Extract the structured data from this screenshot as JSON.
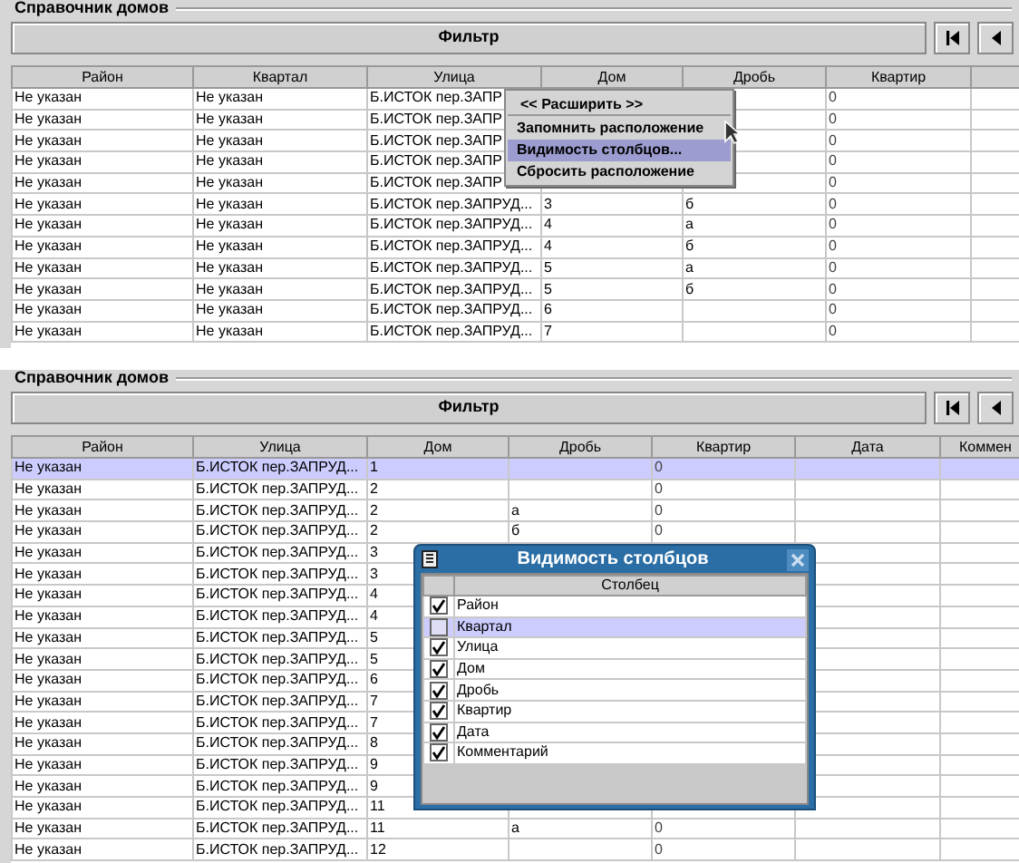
{
  "panels": [
    {
      "title": "Справочник домов",
      "filter_button": "Фильтр",
      "columns": [
        "Район",
        "Квартал",
        "Улица",
        "Дом",
        "Дробь",
        "Квартир"
      ],
      "rows": [
        {
          "selected": false,
          "cells": [
            "Не указан",
            "Не указан",
            "Б.ИСТОК пер.ЗАПР",
            null,
            null,
            "0"
          ]
        },
        {
          "selected": false,
          "cells": [
            "Не указан",
            "Не указан",
            "Б.ИСТОК пер.ЗАПР",
            null,
            null,
            "0"
          ]
        },
        {
          "selected": false,
          "cells": [
            "Не указан",
            "Не указан",
            "Б.ИСТОК пер.ЗАПР",
            null,
            null,
            "0"
          ]
        },
        {
          "selected": false,
          "cells": [
            "Не указан",
            "Не указан",
            "Б.ИСТОК пер.ЗАПР",
            null,
            null,
            "0"
          ]
        },
        {
          "selected": false,
          "cells": [
            "Не указан",
            "Не указан",
            "Б.ИСТОК пер.ЗАПР",
            null,
            null,
            "0"
          ]
        },
        {
          "selected": false,
          "cells": [
            "Не указан",
            "Не указан",
            "Б.ИСТОК пер.ЗАПРУД...",
            "3",
            "б",
            "0"
          ]
        },
        {
          "selected": false,
          "cells": [
            "Не указан",
            "Не указан",
            "Б.ИСТОК пер.ЗАПРУД...",
            "4",
            "а",
            "0"
          ]
        },
        {
          "selected": false,
          "cells": [
            "Не указан",
            "Не указан",
            "Б.ИСТОК пер.ЗАПРУД...",
            "4",
            "б",
            "0"
          ]
        },
        {
          "selected": false,
          "cells": [
            "Не указан",
            "Не указан",
            "Б.ИСТОК пер.ЗАПРУД...",
            "5",
            "а",
            "0"
          ]
        },
        {
          "selected": false,
          "cells": [
            "Не указан",
            "Не указан",
            "Б.ИСТОК пер.ЗАПРУД...",
            "5",
            "б",
            "0"
          ]
        },
        {
          "selected": false,
          "cells": [
            "Не указан",
            "Не указан",
            "Б.ИСТОК пер.ЗАПРУД...",
            "6",
            null,
            "0"
          ]
        },
        {
          "selected": false,
          "cells": [
            "Не указан",
            "Не указан",
            "Б.ИСТОК пер.ЗАПРУД...",
            "7",
            null,
            "0"
          ]
        }
      ],
      "context_menu": [
        {
          "label": "<< Расширить >>",
          "kind": "header",
          "selected": false
        },
        {
          "label": "Запомнить расположение",
          "kind": "item",
          "selected": false
        },
        {
          "label": "Видимость столбцов...",
          "kind": "item",
          "selected": true
        },
        {
          "label": "Сбросить расположение",
          "kind": "item",
          "selected": false
        }
      ]
    },
    {
      "title": "Справочник домов",
      "filter_button": "Фильтр",
      "columns": [
        "Район",
        "Улица",
        "Дом",
        "Дробь",
        "Квартир",
        "Дата",
        "Коммен"
      ],
      "rows": [
        {
          "selected": true,
          "cells": [
            "Не указан",
            "Б.ИСТОК пер.ЗАПРУД...",
            "1",
            null,
            "0",
            null,
            null
          ]
        },
        {
          "selected": false,
          "cells": [
            "Не указан",
            "Б.ИСТОК пер.ЗАПРУД...",
            "2",
            null,
            "0",
            null,
            null
          ]
        },
        {
          "selected": false,
          "cells": [
            "Не указан",
            "Б.ИСТОК пер.ЗАПРУД...",
            "2",
            "а",
            "0",
            null,
            null
          ]
        },
        {
          "selected": false,
          "cells": [
            "Не указан",
            "Б.ИСТОК пер.ЗАПРУД...",
            "2",
            "б",
            "0",
            null,
            null
          ]
        },
        {
          "selected": false,
          "cells": [
            "Не указан",
            "Б.ИСТОК пер.ЗАПРУД...",
            "3",
            null,
            null,
            null,
            null
          ]
        },
        {
          "selected": false,
          "cells": [
            "Не указан",
            "Б.ИСТОК пер.ЗАПРУД...",
            "3",
            null,
            null,
            null,
            null
          ]
        },
        {
          "selected": false,
          "cells": [
            "Не указан",
            "Б.ИСТОК пер.ЗАПРУД...",
            "4",
            null,
            null,
            null,
            null
          ]
        },
        {
          "selected": false,
          "cells": [
            "Не указан",
            "Б.ИСТОК пер.ЗАПРУД...",
            "4",
            null,
            null,
            null,
            null
          ]
        },
        {
          "selected": false,
          "cells": [
            "Не указан",
            "Б.ИСТОК пер.ЗАПРУД...",
            "5",
            null,
            null,
            null,
            null
          ]
        },
        {
          "selected": false,
          "cells": [
            "Не указан",
            "Б.ИСТОК пер.ЗАПРУД...",
            "5",
            null,
            null,
            null,
            null
          ]
        },
        {
          "selected": false,
          "cells": [
            "Не указан",
            "Б.ИСТОК пер.ЗАПРУД...",
            "6",
            null,
            null,
            null,
            null
          ]
        },
        {
          "selected": false,
          "cells": [
            "Не указан",
            "Б.ИСТОК пер.ЗАПРУД...",
            "7",
            null,
            null,
            null,
            null
          ]
        },
        {
          "selected": false,
          "cells": [
            "Не указан",
            "Б.ИСТОК пер.ЗАПРУД...",
            "7",
            null,
            null,
            null,
            null
          ]
        },
        {
          "selected": false,
          "cells": [
            "Не указан",
            "Б.ИСТОК пер.ЗАПРУД...",
            "8",
            null,
            null,
            null,
            null
          ]
        },
        {
          "selected": false,
          "cells": [
            "Не указан",
            "Б.ИСТОК пер.ЗАПРУД...",
            "9",
            null,
            null,
            null,
            null
          ]
        },
        {
          "selected": false,
          "cells": [
            "Не указан",
            "Б.ИСТОК пер.ЗАПРУД...",
            "9",
            null,
            null,
            null,
            null
          ]
        },
        {
          "selected": false,
          "cells": [
            "Не указан",
            "Б.ИСТОК пер.ЗАПРУД...",
            "11",
            null,
            null,
            null,
            null
          ]
        },
        {
          "selected": false,
          "cells": [
            "Не указан",
            "Б.ИСТОК пер.ЗАПРУД...",
            "11",
            "а",
            "0",
            null,
            null
          ]
        },
        {
          "selected": false,
          "cells": [
            "Не указан",
            "Б.ИСТОК пер.ЗАПРУД...",
            "12",
            null,
            "0",
            null,
            null
          ]
        }
      ],
      "dialog": {
        "title": "Видимость столбцов",
        "column_header": "Столбец",
        "items": [
          {
            "label": "Район",
            "checked": true,
            "selected": false
          },
          {
            "label": "Квартал",
            "checked": false,
            "selected": true
          },
          {
            "label": "Улица",
            "checked": true,
            "selected": false
          },
          {
            "label": "Дом",
            "checked": true,
            "selected": false
          },
          {
            "label": "Дробь",
            "checked": true,
            "selected": false
          },
          {
            "label": "Квартир",
            "checked": true,
            "selected": false
          },
          {
            "label": "Дата",
            "checked": true,
            "selected": false
          },
          {
            "label": "Комментарий",
            "checked": true,
            "selected": false
          }
        ]
      }
    }
  ]
}
